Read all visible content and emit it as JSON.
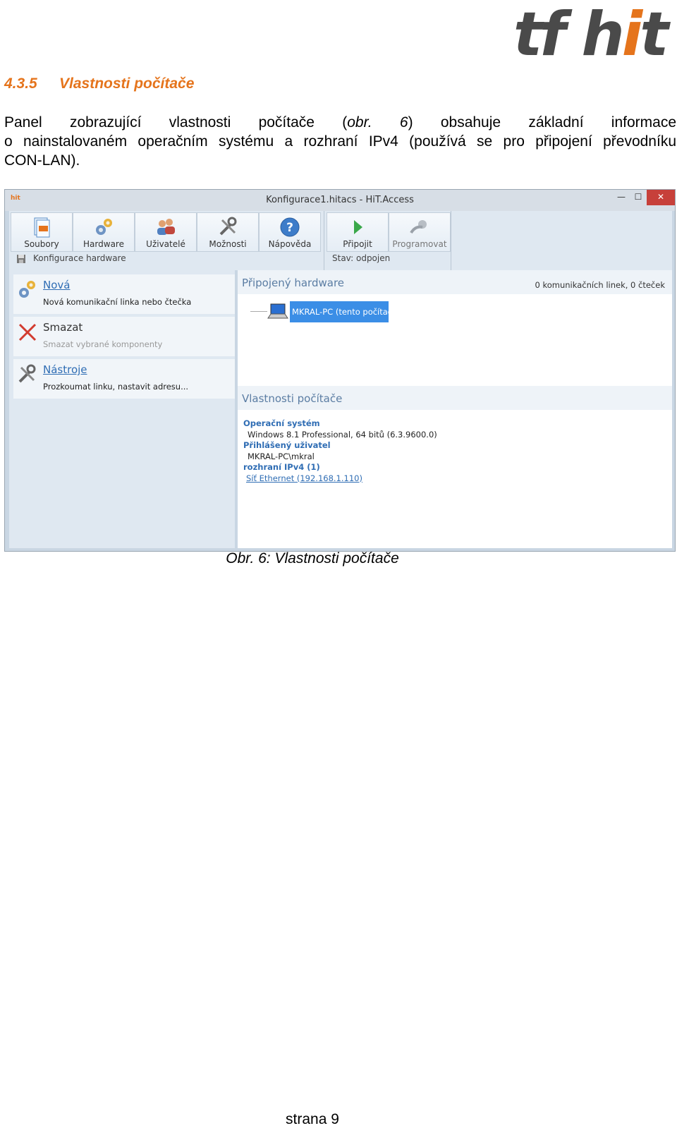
{
  "logo": {
    "text": "tf hit",
    "part1": "tf h",
    "part2": "i",
    "part3": "t",
    "color_dark": "#4a4a4a",
    "color_accent": "#E5741C"
  },
  "heading": {
    "number": "4.3.5",
    "title": "Vlastnosti počítače",
    "color": "#E5741C"
  },
  "paragraph": {
    "line1_a": "Panel zobrazující vlastnosti počítače (",
    "line1_ref": "obr. 6",
    "line1_b": ") obsahuje základní informace",
    "line2": "o nainstalovaném operačním systému a rozhraní IPv4 (používá se pro připojení převodníku",
    "line3": "CON-LAN)."
  },
  "window": {
    "app_icon": "hit",
    "title": "Konfigurace1.hitacs - HiT.Access",
    "controls": {
      "minimize": "—",
      "maximize": "☐",
      "close": "✕"
    },
    "toolbar": [
      {
        "id": "soubory",
        "label": "Soubory",
        "icon": "file-hit-icon"
      },
      {
        "id": "hardware",
        "label": "Hardware",
        "icon": "gears-icon"
      },
      {
        "id": "uzivatele",
        "label": "Uživatelé",
        "icon": "users-icon"
      },
      {
        "id": "moznosti",
        "label": "Možnosti",
        "icon": "tools-icon"
      },
      {
        "id": "napoveda",
        "label": "Nápověda",
        "icon": "help-icon"
      },
      {
        "id": "pripojit",
        "label": "Připojit",
        "icon": "play-icon"
      },
      {
        "id": "programovat",
        "label": "Programovat",
        "icon": "program-icon"
      }
    ],
    "group_labels": {
      "left": "Konfigurace hardware",
      "right": "Stav: odpojen"
    },
    "sidebar": [
      {
        "title": "Nová",
        "desc": "Nová komunikační linka nebo čtečka"
      },
      {
        "title": "Smazat",
        "desc": "Smazat vybrané komponenty"
      },
      {
        "title": "Nástroje",
        "desc": "Prozkoumat linku, nastavit adresu..."
      }
    ],
    "connected": {
      "title": "Připojený hardware",
      "count": "0 komunikačních linek, 0 čteček",
      "device": "MKRAL-PC (tento počítač)"
    },
    "properties": {
      "title": "Vlastnosti počítače",
      "os_label": "Operační systém",
      "os_value": "Windows 8.1 Professional, 64 bitů (6.3.9600.0)",
      "user_label": "Přihlášený uživatel",
      "user_value": "MKRAL-PC\\mkral",
      "ipv4_label": "rozhraní IPv4 (1)",
      "ipv4_value": "Síť Ethernet (192.168.1.110)"
    }
  },
  "caption": "Obr. 6: Vlastnosti počítače",
  "page_number": "strana 9"
}
